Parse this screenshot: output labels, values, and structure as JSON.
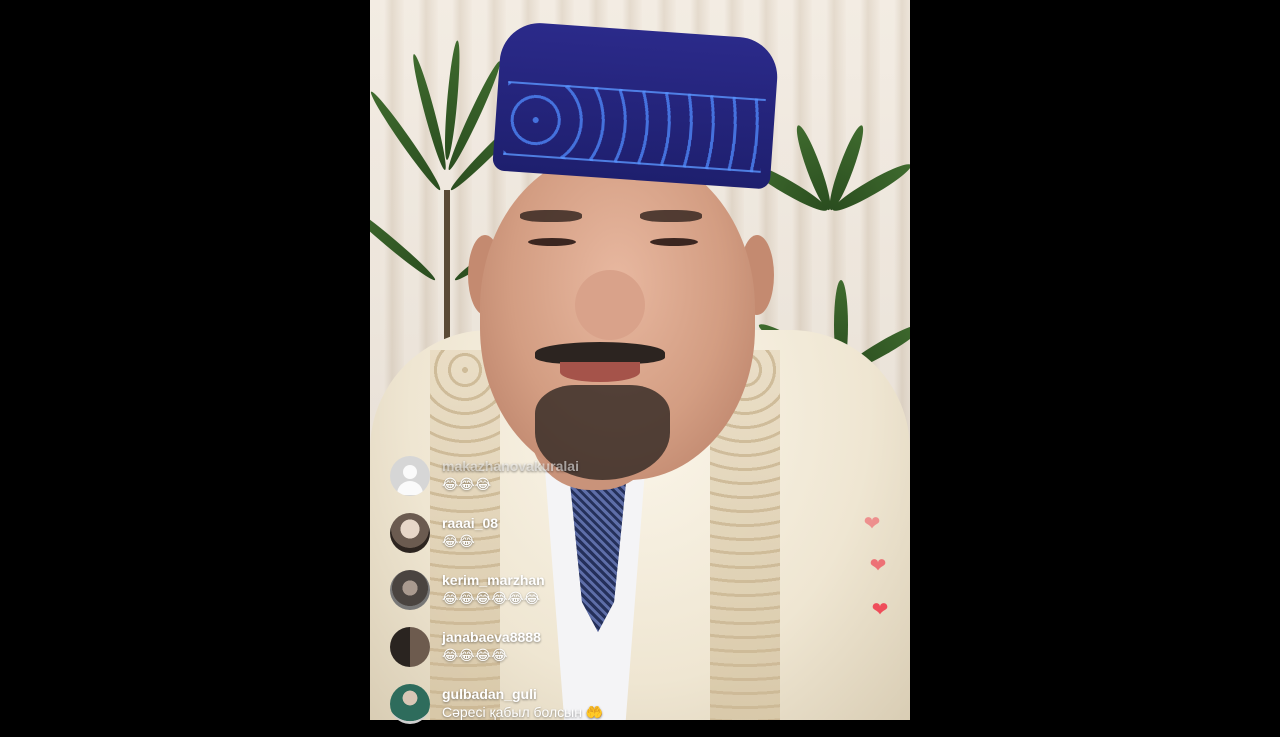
{
  "live_comments": [
    {
      "username": "makazhanovakuralai",
      "message": "😂😂😂",
      "faded": true
    },
    {
      "username": "raaai_08",
      "message": "😂😂"
    },
    {
      "username": "kerim_marzhan",
      "message": "😂😂😂😂😂😂"
    },
    {
      "username": "janabaeva8888",
      "message": "😂😂😂😂"
    },
    {
      "username": "gulbadan_guli",
      "message": "Сәресі қабыл болсын 🤲"
    }
  ],
  "reactions": {
    "heart_icon": "❤",
    "count_visible": 3
  },
  "colors": {
    "letterbox": "#000000",
    "heart": "#ef4d5a",
    "comment_text": "#ffffff"
  }
}
